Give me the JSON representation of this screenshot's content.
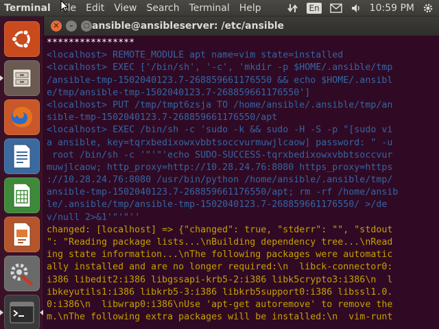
{
  "top_panel": {
    "app_title": "Terminal",
    "menus": [
      "File",
      "Edit",
      "View",
      "Search",
      "Terminal",
      "Help"
    ],
    "language": "En",
    "clock": "10:59 PM"
  },
  "launcher": {
    "items": [
      "ubuntu-logo",
      "files",
      "firefox",
      "libreoffice-writer",
      "libreoffice-calc",
      "libreoffice-impress",
      "system-settings",
      "terminal"
    ]
  },
  "window": {
    "title": "ansible@ansibleserver: /etc/ansible",
    "lines": [
      {
        "color": "white",
        "text": "****************"
      },
      {
        "color": "blue",
        "text": "<localhost> REMOTE_MODULE apt name=vim state=installed"
      },
      {
        "color": "blue",
        "text": "<localhost> EXEC ['/bin/sh', '-c', 'mkdir -p $HOME/.ansible/tmp"
      },
      {
        "color": "blue",
        "text": "/ansible-tmp-1502040123.7-268859661176550 && echo $HOME/.ansibl"
      },
      {
        "color": "blue",
        "text": "e/tmp/ansible-tmp-1502040123.7-268859661176550']"
      },
      {
        "color": "blue",
        "text": "<localhost> PUT /tmp/tmpt6zsja TO /home/ansible/.ansible/tmp/an"
      },
      {
        "color": "blue",
        "text": "sible-tmp-1502040123.7-268859661176550/apt"
      },
      {
        "color": "blue",
        "text": "<localhost> EXEC /bin/sh -c 'sudo -k && sudo -H -S -p \"[sudo vi"
      },
      {
        "color": "blue",
        "text": "a ansible, key=tqrxbedixowxvbbtsoccvurmuwjlcaow] password: \" -u"
      },
      {
        "color": "blue",
        "text": " root /bin/sh -c '\"'\"'echo SUDO-SUCCESS-tqrxbedixowxvbbtsoccvur"
      },
      {
        "color": "blue",
        "text": "muwjlcaow; http_proxy=http://10.28.24.76:8080 https_proxy=https"
      },
      {
        "color": "blue",
        "text": "://10.28.24.76:8080 /usr/bin/python /home/ansible/.ansible/tmp/"
      },
      {
        "color": "blue",
        "text": "ansible-tmp-1502040123.7-268859661176550/apt; rm -rf /home/ansib"
      },
      {
        "color": "blue",
        "text": "le/.ansible/tmp/ansible-tmp-1502040123.7-268859661176550/ >/de"
      },
      {
        "color": "blue",
        "text": "v/null 2>&1'\"'\"''"
      },
      {
        "color": "yellow",
        "text": "changed: [localhost] => {\"changed\": true, \"stderr\": \"\", \"stdout"
      },
      {
        "color": "yellow",
        "text": "\": \"Reading package lists...\\nBuilding dependency tree...\\nRead"
      },
      {
        "color": "yellow",
        "text": "ing state information...\\nThe following packages were automatic"
      },
      {
        "color": "yellow",
        "text": "ally installed and are no longer required:\\n  libck-connector0:"
      },
      {
        "color": "yellow",
        "text": "i386 libedit2:i386 libgssapi-krb5-2:i386 libk5crypto3:i386\\n  l"
      },
      {
        "color": "yellow",
        "text": "ibkeyutils1:i386 libkrb5-3:i386 libkrb5support0:i386 libssl1.0."
      },
      {
        "color": "yellow",
        "text": "0:i386\\n  libwrap0:i386\\nUse 'apt-get autoremove' to remove the"
      },
      {
        "color": "yellow",
        "text": "m.\\nThe following extra packages will be installed:\\n  vim-runt"
      }
    ]
  },
  "colors": {
    "terminal_bg": "#300a24",
    "blue": "#3465a4",
    "yellow": "#c4a000",
    "white": "#ffffff"
  }
}
